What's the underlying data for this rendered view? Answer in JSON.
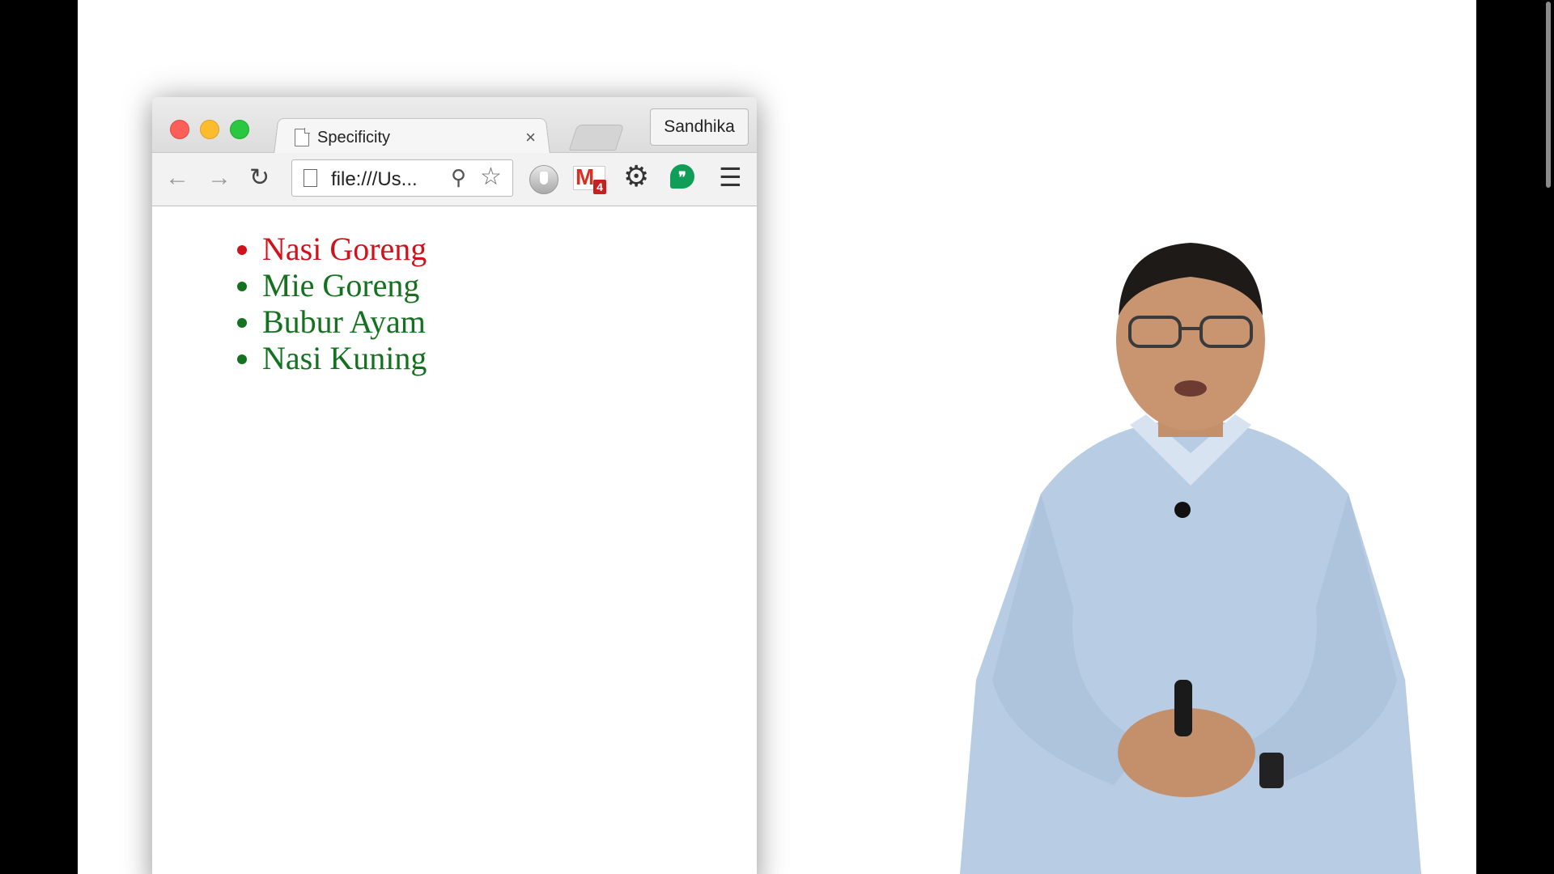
{
  "browser": {
    "tab_title": "Specificity",
    "tab_close": "×",
    "profile_name": "Sandhika",
    "url_display": "file:///Us...",
    "gmail_badge": "4",
    "hangouts_glyph": "❞"
  },
  "page": {
    "list_items": [
      {
        "text": "Nasi Goreng",
        "color": "#d0121b"
      },
      {
        "text": "Mie Goreng",
        "color": "#14711f"
      },
      {
        "text": "Bubur Ayam",
        "color": "#14711f"
      },
      {
        "text": "Nasi Kuning",
        "color": "#14711f"
      }
    ]
  },
  "colors": {
    "traffic_red": "#fc5f57",
    "traffic_yellow": "#fdbc2e",
    "traffic_green": "#29c840",
    "shirt_blue": "#b8cde4"
  },
  "icons": {
    "back": "back-arrow-icon",
    "forward": "forward-arrow-icon",
    "reload": "reload-icon",
    "zoom": "zoom-icon",
    "star": "bookmark-star-icon",
    "gear": "gear-icon",
    "menu": "hamburger-menu-icon"
  }
}
